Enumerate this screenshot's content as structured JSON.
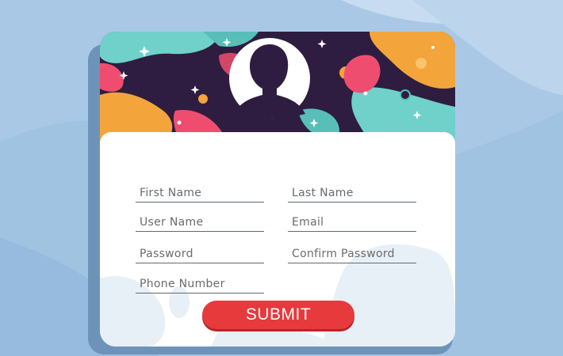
{
  "form": {
    "fields": {
      "first_name": "First Name",
      "last_name": "Last Name",
      "user_name": "User Name",
      "email": "Email",
      "password": "Password",
      "confirm_password": "Confirm Password",
      "phone_number": "Phone Number"
    },
    "submit_label": "SUBMIT"
  },
  "icons": {
    "avatar": "user-silhouette-icon"
  },
  "colors": {
    "background": "#a9c8e6",
    "card": "#ffffff",
    "banner_dark": "#2e1d40",
    "accent_teal": "#6fd1c9",
    "accent_orange": "#f3a43b",
    "accent_pink": "#ef4d70",
    "submit": "#e63a3c"
  }
}
